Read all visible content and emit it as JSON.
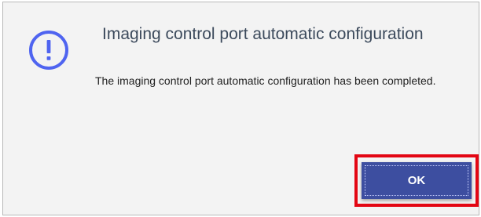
{
  "dialog": {
    "icon": "exclamation-circle-icon",
    "title": "Imaging control port automatic configuration",
    "message": "The imaging control port automatic configuration has been completed.",
    "ok_label": "OK"
  },
  "colors": {
    "icon": "#4f64f0",
    "title": "#3c4a5c",
    "button": "#3d4ea0",
    "highlight": "#e30613",
    "background": "#f3f3f3"
  }
}
